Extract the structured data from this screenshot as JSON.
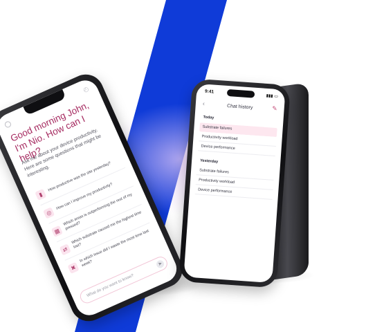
{
  "colors": {
    "stripe_blue": "#0f3bd8",
    "accent_pink": "#a5295f",
    "highlight_pink": "#fde7ef",
    "phone_body": "#0f0f12"
  },
  "assistant_screen": {
    "greeting": "Good morning John, I'm Nio. How can I help?",
    "intro": "Ask me about your device productivity. Here are some questions that might be interesting.",
    "suggestions": [
      {
        "icon": "chart-icon",
        "text": "How productive was the site yesterday?"
      },
      {
        "icon": "lightbulb-icon",
        "text": "How can I improve my productivity?"
      },
      {
        "icon": "grid-icon",
        "text": "Which areas is outperforming the rest of my pressed?"
      },
      {
        "icon": "arrows-icon",
        "text": "Which substrate caused me the highest time lost?"
      },
      {
        "icon": "tools-icon",
        "text": "In which issue did I waste the most time last week?"
      }
    ],
    "input_placeholder": "What do you want to know?"
  },
  "history_screen": {
    "status_time": "9:41",
    "title": "Chat history",
    "sections": [
      {
        "label": "Today",
        "items": [
          "Substrate failures",
          "Productivity workload",
          "Device performance"
        ],
        "active_index": 0
      },
      {
        "label": "Yesterday",
        "items": [
          "Substrate failures",
          "Productivity workload",
          "Device performance"
        ],
        "active_index": -1
      }
    ]
  }
}
